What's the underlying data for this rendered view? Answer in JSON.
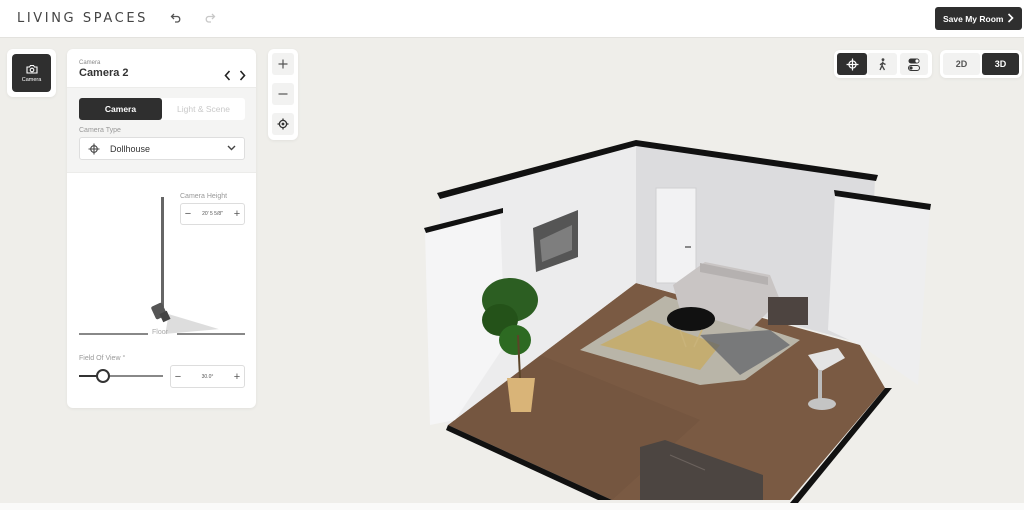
{
  "app": {
    "logo": "LIVING SPACES",
    "save_button": "Save My Room"
  },
  "toolbar": {
    "undo_icon": "undo-icon",
    "redo_icon": "redo-icon"
  },
  "rail": {
    "camera_label": "Camera"
  },
  "camera_panel": {
    "subtitle": "Camera",
    "title": "Camera 2",
    "tabs": [
      {
        "label": "Camera",
        "active": true
      },
      {
        "label": "Light & Scene",
        "active": false
      }
    ],
    "camera_type_label": "Camera Type",
    "camera_type_value": "Dollhouse",
    "camera_height_label": "Camera Height",
    "camera_height_value": "20' 5 5/8\"",
    "floor_label": "Floor",
    "fov_label": "Field Of View °",
    "fov_value": "30.0°",
    "fov_fraction": 0.29
  },
  "view_controls": {
    "zoom_in": "+",
    "zoom_out": "−",
    "modes": [
      {
        "name": "dollhouse",
        "active": true
      },
      {
        "name": "walk",
        "active": false
      },
      {
        "name": "toggles",
        "active": false
      }
    ],
    "dims": [
      {
        "label": "2D",
        "active": false
      },
      {
        "label": "3D",
        "active": true
      }
    ]
  },
  "colors": {
    "accent_dark": "#2f2f2f",
    "background": "#efeeea",
    "floor_wood": "#7a5a43"
  }
}
